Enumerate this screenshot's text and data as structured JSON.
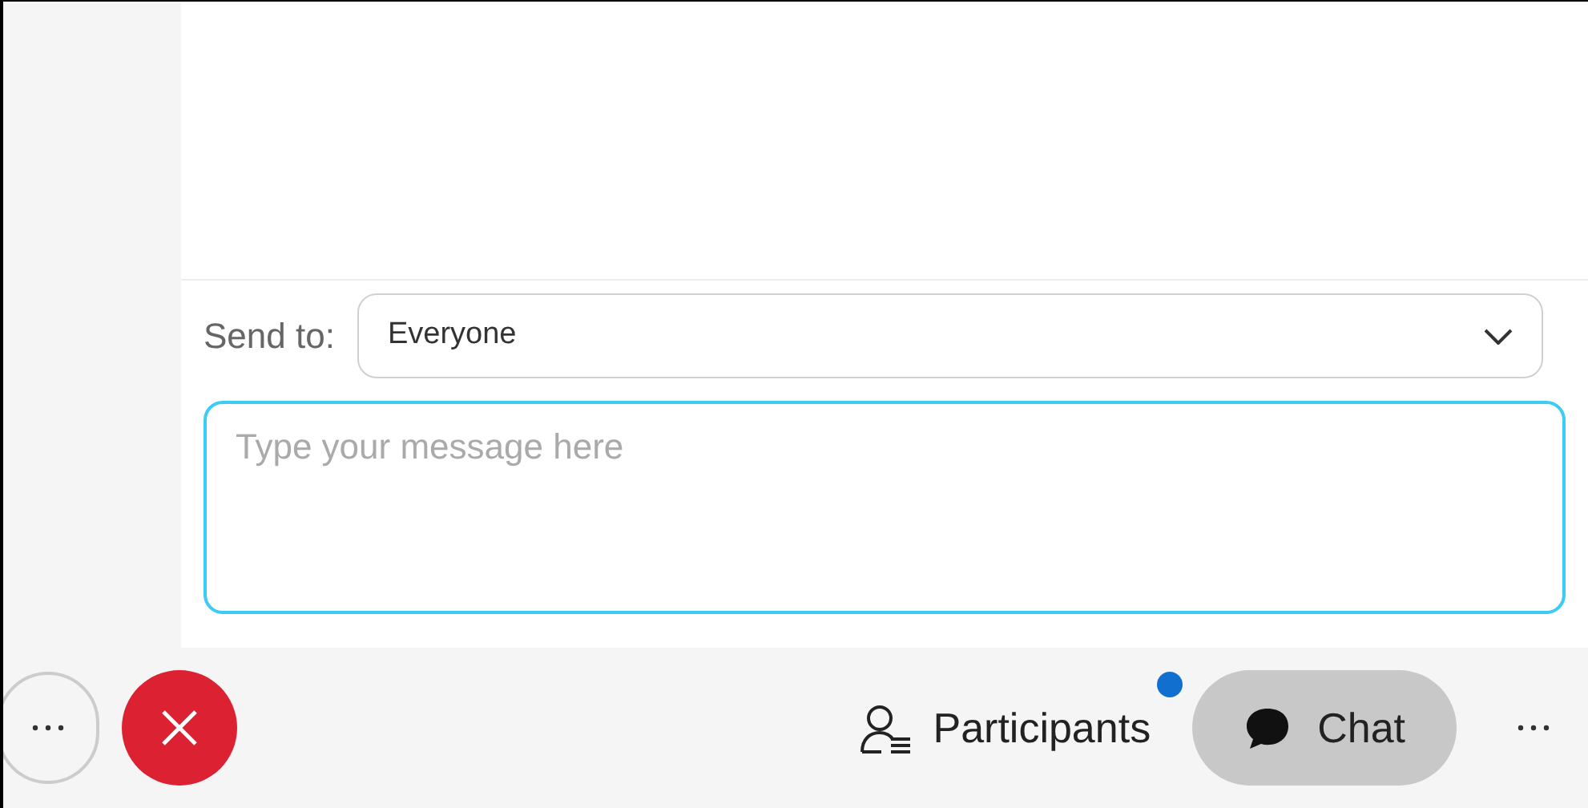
{
  "send_to": {
    "label": "Send to:",
    "value": "Everyone"
  },
  "message": {
    "placeholder": "Type your message here"
  },
  "toolbar": {
    "participants": {
      "label": "Participants",
      "notification": true
    },
    "chat": {
      "label": "Chat",
      "selected": true
    }
  }
}
